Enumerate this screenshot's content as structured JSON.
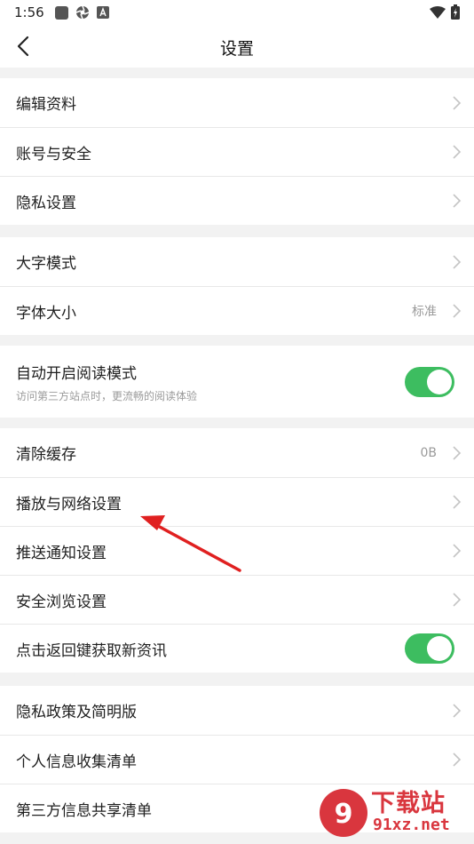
{
  "status_bar": {
    "time": "1:56",
    "left_icons": [
      "app-square-icon",
      "aperture-icon",
      "text-a-icon"
    ],
    "right_icons": [
      "wifi-icon",
      "battery-icon"
    ]
  },
  "header": {
    "back_icon": "chevron-left-icon",
    "title": "设置"
  },
  "groups": [
    {
      "rows": [
        {
          "label": "编辑资料",
          "trailing": "chevron"
        },
        {
          "label": "账号与安全",
          "trailing": "chevron"
        },
        {
          "label": "隐私设置",
          "trailing": "chevron"
        }
      ]
    },
    {
      "rows": [
        {
          "label": "大字模式",
          "trailing": "chevron"
        },
        {
          "label": "字体大小",
          "value": "标准",
          "trailing": "chevron"
        }
      ]
    },
    {
      "rows": [
        {
          "label": "自动开启阅读模式",
          "subtitle": "访问第三方站点时，更流畅的阅读体验",
          "trailing": "toggle",
          "toggle_on": true
        }
      ]
    },
    {
      "rows": [
        {
          "label": "清除缓存",
          "value": "0B",
          "trailing": "chevron"
        },
        {
          "label": "播放与网络设置",
          "trailing": "chevron"
        },
        {
          "label": "推送通知设置",
          "trailing": "chevron"
        },
        {
          "label": "安全浏览设置",
          "trailing": "chevron"
        },
        {
          "label": "点击返回键获取新资讯",
          "trailing": "toggle",
          "toggle_on": true
        }
      ]
    },
    {
      "rows": [
        {
          "label": "隐私政策及简明版",
          "trailing": "chevron"
        },
        {
          "label": "个人信息收集清单",
          "trailing": "chevron"
        },
        {
          "label": "第三方信息共享清单",
          "trailing": "chevron"
        }
      ]
    }
  ],
  "annotation": {
    "type": "red-arrow",
    "points_to": "播放与网络设置",
    "color": "#e02020"
  },
  "watermark": {
    "big_text": "下载站",
    "small_text": "91xz.net",
    "color": "#d9363e"
  },
  "colors": {
    "toggle_on": "#3dbd60",
    "background": "#f2f2f2",
    "chevron": "#c4c4c4"
  }
}
